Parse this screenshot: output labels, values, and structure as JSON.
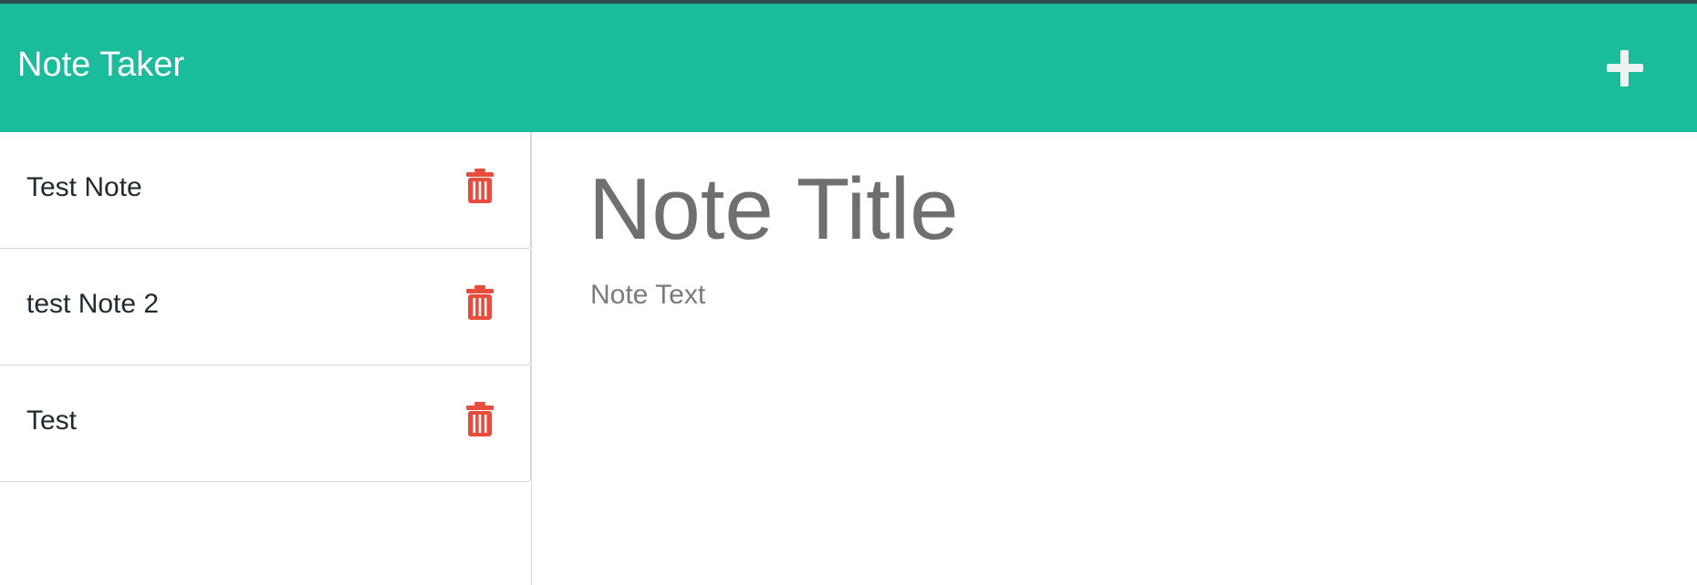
{
  "navbar": {
    "brand": "Note Taker",
    "new_note_icon": "plus-icon",
    "background": "#1abc9c"
  },
  "sidebar": {
    "notes": [
      {
        "title": "Test Note",
        "delete_icon": "trash-icon"
      },
      {
        "title": "test Note 2",
        "delete_icon": "trash-icon"
      },
      {
        "title": "Test",
        "delete_icon": "trash-icon"
      }
    ],
    "delete_color": "#e74c3c"
  },
  "editor": {
    "title_placeholder": "Note Title",
    "text_placeholder": "Note Text"
  }
}
